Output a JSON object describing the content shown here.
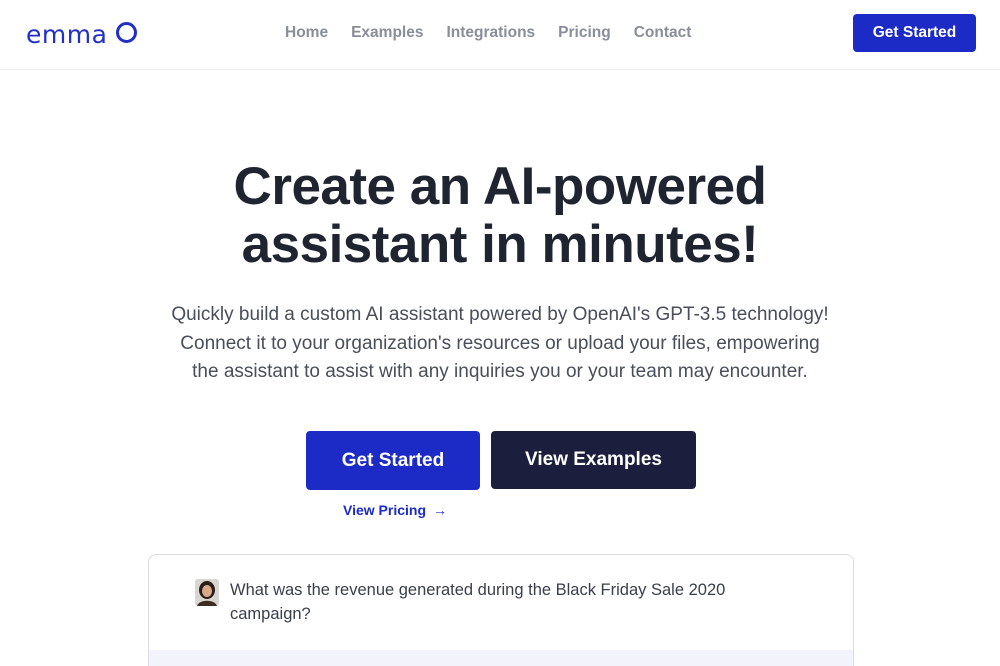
{
  "brand": {
    "name": "emma"
  },
  "nav": {
    "items": [
      "Home",
      "Examples",
      "Integrations",
      "Pricing",
      "Contact"
    ],
    "cta_label": "Get Started"
  },
  "hero": {
    "title_line1": "Create an AI-powered",
    "title_line2": "assistant in minutes!",
    "subtitle_line1": "Quickly build a custom AI assistant powered by OpenAI's GPT-3.5 technology!",
    "subtitle_line2": "Connect it to your organization's resources or upload your files, empowering",
    "subtitle_line3": "the assistant to assist with any inquiries you or your team may encounter.",
    "primary_label": "Get Started",
    "secondary_label": "View Examples",
    "pricing_link": "View Pricing",
    "arrow": "→"
  },
  "chat": {
    "question": "What was the revenue generated during the Black Friday Sale 2020 campaign?"
  },
  "colors": {
    "brand_blue": "#1d2bc6",
    "dark_button": "#1b1f3d",
    "nav_gray": "#8a8e99"
  }
}
